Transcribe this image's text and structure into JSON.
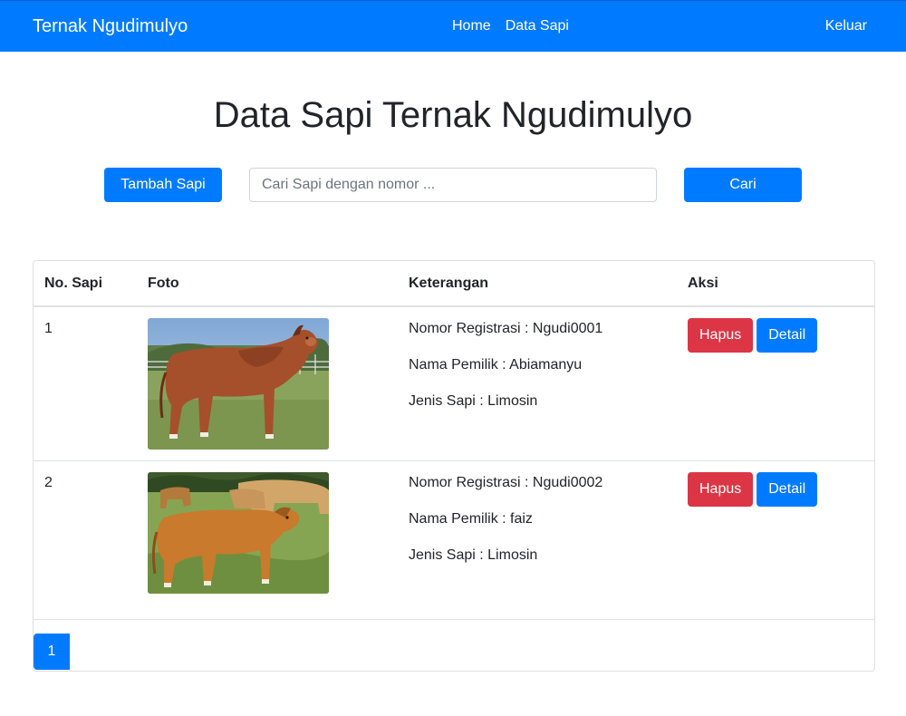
{
  "navbar": {
    "brand": "Ternak Ngudimulyo",
    "links": [
      "Home",
      "Data Sapi"
    ],
    "logout": "Keluar"
  },
  "page": {
    "title": "Data Sapi Ternak Ngudimulyo"
  },
  "toolbar": {
    "add_label": "Tambah Sapi",
    "search_placeholder": "Cari Sapi dengan nomor ...",
    "search_value": "",
    "search_label": "Cari"
  },
  "table": {
    "headers": [
      "No. Sapi",
      "Foto",
      "Keterangan",
      "Aksi"
    ],
    "rows": [
      {
        "no": "1",
        "registrasi": "Nomor Registrasi : Ngudi0001",
        "pemilik": "Nama Pemilik : Abiamanyu",
        "jenis": "Jenis Sapi : Limosin",
        "delete_label": "Hapus",
        "detail_label": "Detail"
      },
      {
        "no": "2",
        "registrasi": "Nomor Registrasi : Ngudi0002",
        "pemilik": "Nama Pemilik : faiz",
        "jenis": "Jenis Sapi : Limosin",
        "delete_label": "Hapus",
        "detail_label": "Detail"
      }
    ]
  },
  "pagination": {
    "current": "1"
  },
  "colors": {
    "primary": "#007bff",
    "danger": "#dc3545",
    "text": "#212529"
  }
}
